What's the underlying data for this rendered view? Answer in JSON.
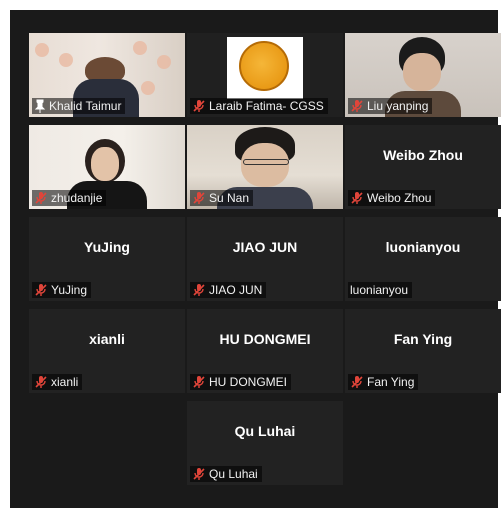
{
  "participants": [
    {
      "name": "Khalid Taimur",
      "icon": "pin-icon",
      "video": true,
      "speaking": true
    },
    {
      "name": "Laraib Fatima- CGSS",
      "icon": "mic-muted-icon",
      "video": true
    },
    {
      "name": "Liu yanping",
      "icon": "mic-muted-icon",
      "video": true
    },
    {
      "name": "zhudanjie",
      "icon": "mic-muted-icon",
      "video": true
    },
    {
      "name": "Su Nan",
      "icon": "mic-muted-icon",
      "video": true
    },
    {
      "name": "Weibo Zhou",
      "display": "Weibo Zhou",
      "icon": "mic-muted-icon",
      "video": false
    },
    {
      "name": "YuJing",
      "display": "YuJing",
      "icon": "mic-muted-icon",
      "video": false
    },
    {
      "name": "JIAO JUN",
      "display": "JIAO JUN",
      "icon": "mic-muted-icon",
      "video": false
    },
    {
      "name": "luonianyou",
      "display": "luonianyou",
      "icon": "none",
      "video": false
    },
    {
      "name": "xianli",
      "display": "xianli",
      "icon": "mic-muted-icon",
      "video": false
    },
    {
      "name": "HU DONGMEI",
      "display": "HU DONGMEI",
      "icon": "mic-muted-icon",
      "video": false
    },
    {
      "name": "Fan Ying",
      "display": "Fan Ying",
      "icon": "mic-muted-icon",
      "video": false
    },
    {
      "name": "Qu Luhai",
      "display": "Qu Luhai",
      "icon": "mic-muted-icon",
      "video": false
    }
  ],
  "colors": {
    "background": "#1a1a1a",
    "tile": "#222222",
    "active_speaker_border": "#c5e25a",
    "muted_mic": "#e0453a"
  }
}
